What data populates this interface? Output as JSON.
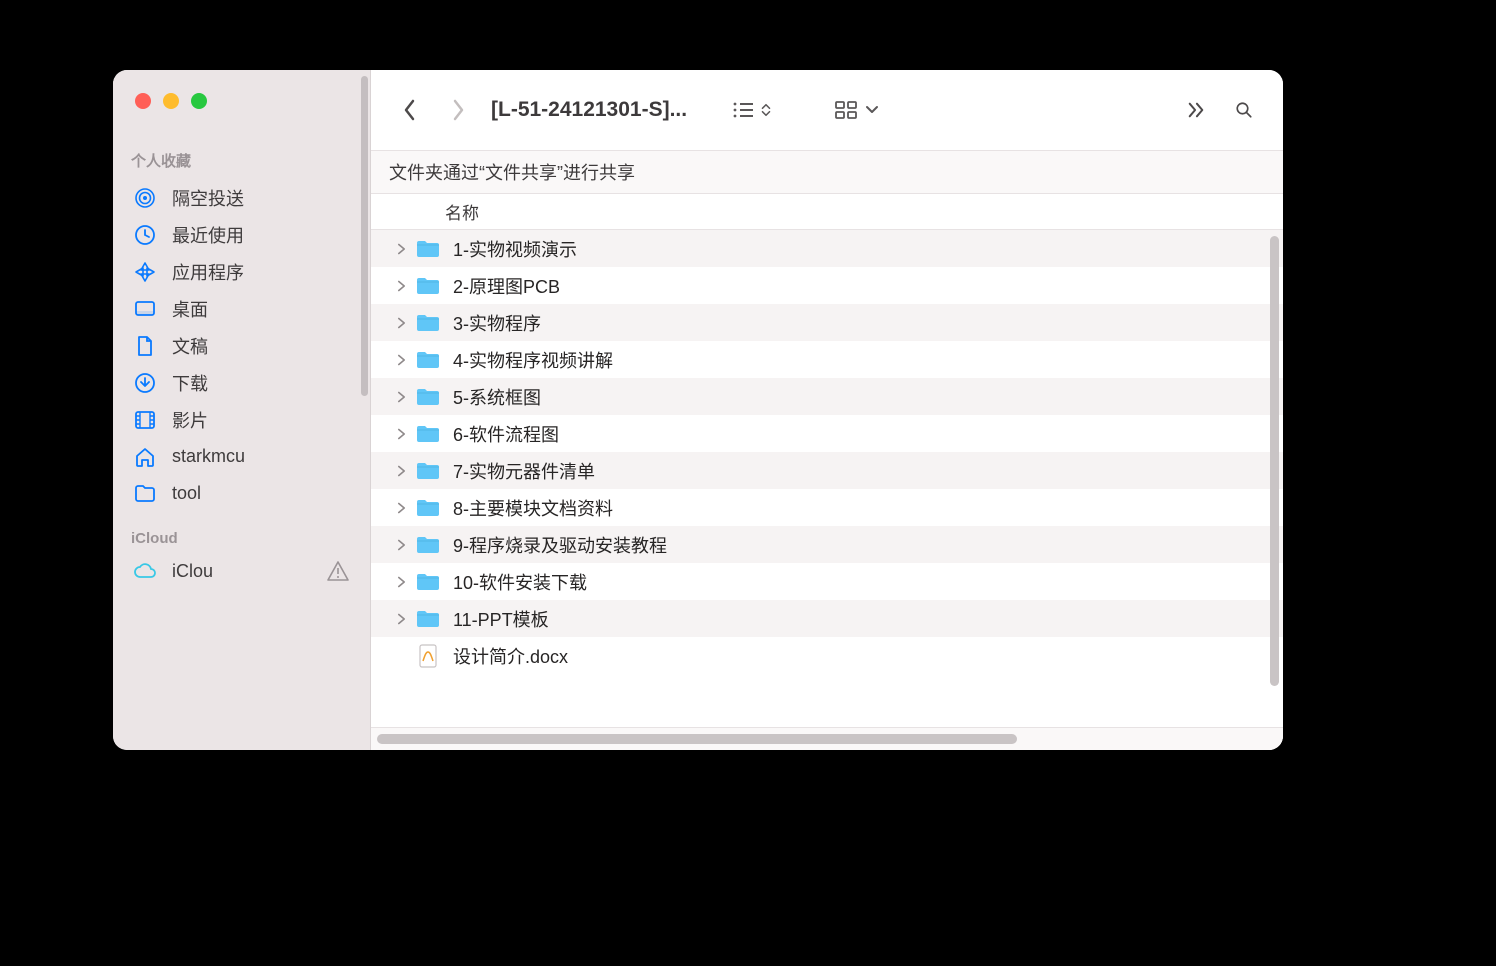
{
  "toolbar": {
    "title": "[L-51-24121301-S]..."
  },
  "sidebar": {
    "favorites_label": "个人收藏",
    "icloud_label": "iCloud",
    "items": [
      {
        "label": "隔空投送",
        "icon": "airdrop"
      },
      {
        "label": "最近使用",
        "icon": "clock"
      },
      {
        "label": "应用程序",
        "icon": "apps"
      },
      {
        "label": "桌面",
        "icon": "desktop"
      },
      {
        "label": "文稿",
        "icon": "doc"
      },
      {
        "label": "下载",
        "icon": "download"
      },
      {
        "label": "影片",
        "icon": "movies"
      },
      {
        "label": "starkmcu",
        "icon": "home"
      },
      {
        "label": "tool",
        "icon": "folder"
      }
    ],
    "icloud_item": {
      "label": "iClou",
      "icon": "cloud"
    }
  },
  "share_notice": "文件夹通过“文件共享”进行共享",
  "column_header": "名称",
  "files": [
    {
      "name": "1-实物视频演示",
      "type": "folder"
    },
    {
      "name": "2-原理图PCB",
      "type": "folder"
    },
    {
      "name": "3-实物程序",
      "type": "folder"
    },
    {
      "name": "4-实物程序视频讲解",
      "type": "folder"
    },
    {
      "name": "5-系统框图",
      "type": "folder"
    },
    {
      "name": "6-软件流程图",
      "type": "folder"
    },
    {
      "name": "7-实物元器件清单",
      "type": "folder"
    },
    {
      "name": "8-主要模块文档资料",
      "type": "folder"
    },
    {
      "name": "9-程序烧录及驱动安装教程",
      "type": "folder"
    },
    {
      "name": "10-软件安装下载",
      "type": "folder"
    },
    {
      "name": "11-PPT模板",
      "type": "folder"
    },
    {
      "name": "设计简介.docx",
      "type": "docx"
    }
  ]
}
